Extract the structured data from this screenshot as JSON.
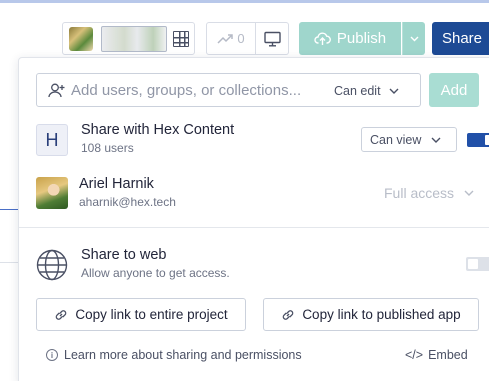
{
  "toolbar": {
    "trend_count": "0",
    "publish_label": "Publish",
    "share_label": "Share"
  },
  "invite": {
    "placeholder": "Add users, groups, or collections...",
    "permission": "Can edit",
    "add_label": "Add"
  },
  "workspace": {
    "badge": "H",
    "title": "Share with Hex Content",
    "subtitle": "108 users",
    "permission": "Can view",
    "enabled": true
  },
  "owner": {
    "name": "Ariel Harnik",
    "email": "aharnik@hex.tech",
    "access": "Full access"
  },
  "web": {
    "title": "Share to web",
    "subtitle": "Allow anyone to get access.",
    "enabled": false
  },
  "links": {
    "copy_project": "Copy link to entire project",
    "copy_app": "Copy link to published app"
  },
  "footer": {
    "learn_more": "Learn more about sharing and permissions",
    "embed": "Embed",
    "embed_icon": "</>"
  },
  "icons": {
    "info": "i"
  },
  "colors": {
    "primary": "#1d4a95",
    "publish": "#9fd6cc",
    "toggle_on": "#2150a8"
  }
}
